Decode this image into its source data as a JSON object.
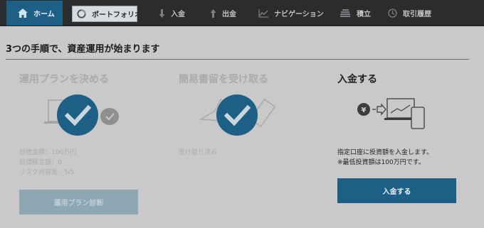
{
  "nav": {
    "home": {
      "label": "ホーム",
      "icon": "home-icon"
    },
    "portfolio": {
      "label": "ポートフォリオ",
      "icon": "portfolio-icon"
    },
    "deposit": {
      "label": "入金",
      "icon": "deposit-arrow-icon"
    },
    "withdraw": {
      "label": "出金",
      "icon": "withdraw-arrow-icon"
    },
    "navigation": {
      "label": "ナビゲーション",
      "icon": "chart-line-icon"
    },
    "tsumitate": {
      "label": "積立",
      "icon": "coin-stack-icon"
    },
    "history": {
      "label": "取引履歴",
      "icon": "clock-icon"
    }
  },
  "main": {
    "title": "3つの手順で、資産運用が始まります",
    "steps": [
      {
        "title": "運用プランを決める",
        "status": "done",
        "details": [
          "目標金額：100万円",
          "目標積立額：0",
          "リスク許容度：5/5"
        ],
        "button_label": "運用プラン診断"
      },
      {
        "title": "簡易書留を受け取る",
        "status": "done",
        "details": [
          "受け取り済み"
        ]
      },
      {
        "title": "入金する",
        "status": "current",
        "details": [
          "指定口座に投資額を入金します。",
          "※最低投資額は100万円です。"
        ],
        "button_label": "入金する"
      }
    ]
  },
  "colors": {
    "accent": "#1e5f86",
    "nav_bg": "#2a2c2e",
    "page_bg": "#c9c9c9",
    "disabled_button": "#8fa6b3"
  }
}
